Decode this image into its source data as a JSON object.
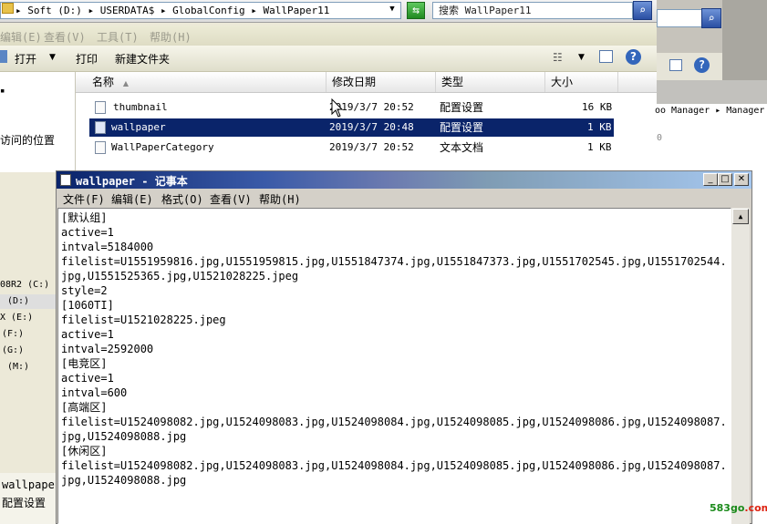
{
  "explorer": {
    "address_path": "▸ Soft (D:) ▸ USERDATA$ ▸ GlobalConfig ▸ WallPaper11",
    "search_placeholder": "搜索 WallPaper11",
    "menu": [
      "编辑(E)",
      "查看(V)",
      "工具(T)",
      "帮助(H)"
    ],
    "toolbar": {
      "open": "打开",
      "print": "打印",
      "new_folder": "新建文件夹"
    },
    "columns": {
      "name": "名称",
      "date": "修改日期",
      "type": "类型",
      "size": "大小"
    },
    "files": [
      {
        "name": "thumbnail",
        "date": "2019/3/7 20:52",
        "type": "配置设置",
        "size": "16 KB",
        "date_partial": "19/3/7 20:52"
      },
      {
        "name": "wallpaper",
        "date": "2019/3/7 20:48",
        "type": "配置设置",
        "size": "1 KB"
      },
      {
        "name": "WallPaperCategory",
        "date": "2019/3/7 20:52",
        "type": "文本文档",
        "size": "1 KB"
      }
    ],
    "nav": {
      "recent_label": "访问的位置"
    },
    "drives": [
      "08R2 (C:)",
      "(D:)",
      "X (E:)",
      "(F:)",
      "(G:)",
      "(M:)"
    ],
    "details_name": "wallpape",
    "details_type": "配置设置"
  },
  "right_window": {
    "path_text": "oo Manager ▸ Manager",
    "digit": "0"
  },
  "notepad": {
    "title": "wallpaper - 记事本",
    "menu": [
      "文件(F)",
      "编辑(E)",
      "格式(O)",
      "查看(V)",
      "帮助(H)"
    ],
    "content": "[默认组]\nactive=1\nintval=5184000\nfilelist=U1551959816.jpg,U1551959815.jpg,U1551847374.jpg,U1551847373.jpg,U1551702545.jpg,U1551702544.jpg,U1551525365.jpg,U1521028225.jpeg\nstyle=2\n[1060TI]\nfilelist=U1521028225.jpeg\nactive=1\nintval=2592000\n[电竞区]\nactive=1\nintval=600\n[高端区]\nfilelist=U1524098082.jpg,U1524098083.jpg,U1524098084.jpg,U1524098085.jpg,U1524098086.jpg,U1524098087.jpg,U1524098088.jpg\n[休闲区]\nfilelist=U1524098082.jpg,U1524098083.jpg,U1524098084.jpg,U1524098085.jpg,U1524098086.jpg,U1524098087.jpg,U1524098088.jpg"
  },
  "watermark": {
    "green": "583go",
    "red": ".com"
  }
}
